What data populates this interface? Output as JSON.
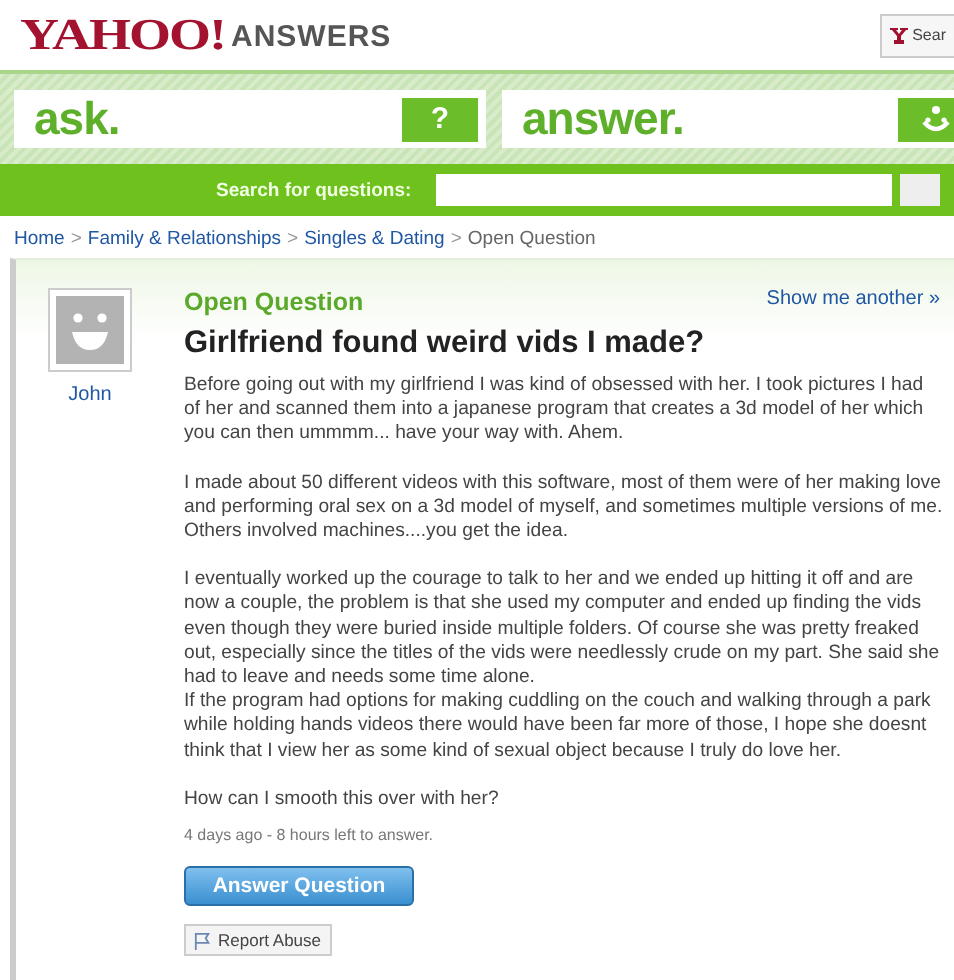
{
  "header": {
    "logo": "YAHOO!",
    "product": "ANSWERS",
    "search_button": "Sear"
  },
  "ask": {
    "label": "ask.",
    "icon": "?"
  },
  "answer": {
    "label": "answer."
  },
  "search": {
    "label": "Search for questions:"
  },
  "breadcrumb": [
    {
      "label": "Home",
      "link": true
    },
    {
      "label": "Family & Relationships",
      "link": true
    },
    {
      "label": "Singles & Dating",
      "link": true
    },
    {
      "label": "Open Question",
      "link": false
    }
  ],
  "breadcrumb_separator": ">",
  "question": {
    "user": "John",
    "status": "Open Question",
    "show_another": "Show me another »",
    "title": "Girlfriend found weird vids I made?",
    "paragraphs": [
      "Before going out with my girlfriend I was kind of obsessed with her. I took pictures I had of her and scanned them into a japanese program that creates a 3d model of her which you can then ummmm... have your way with. Ahem.",
      "I made about 50 different videos with this software, most of them were of her making love and performing oral sex on a 3d model of myself, and sometimes multiple versions of me. Others involved machines....you get the idea.",
      "I eventually worked up the courage to talk to her and we ended up hitting it off and are now a couple, the problem is that she used my computer and ended up finding the vids even though they were buried inside multiple folders. Of course she was pretty freaked out, especially since the titles of the vids were needlessly crude on my part. She said she had to leave and needs some time alone.\nIf the program had options for making cuddling on the couch and walking through a park while holding hands videos there would have been far more of those, I hope she doesnt think that I view her as some kind of sexual object because I truly do love her.",
      "How can I smooth this over with her?"
    ],
    "meta": "4 days ago - 8 hours left to answer.",
    "answer_button": "Answer Question",
    "report_button": "Report Abuse"
  }
}
